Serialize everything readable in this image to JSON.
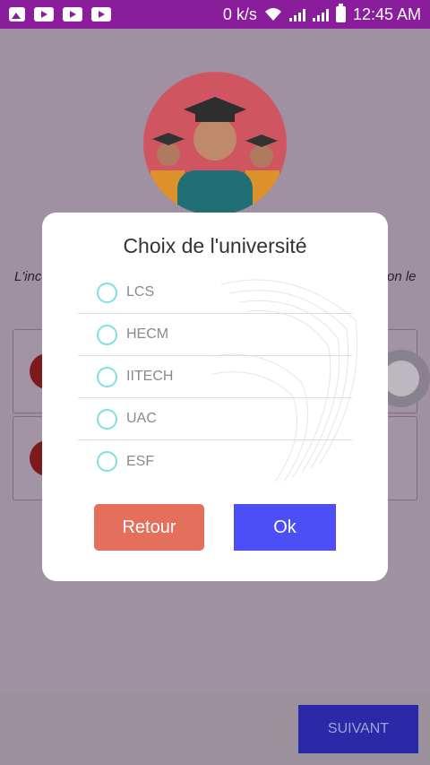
{
  "status_bar": {
    "network_speed": "0 k/s",
    "time": "12:45 AM",
    "icons": [
      "gallery-icon",
      "youtube-icon",
      "youtube-icon",
      "youtube-icon",
      "wifi-icon",
      "signal-icon",
      "signal-icon",
      "battery-icon"
    ]
  },
  "background": {
    "description_left": "L'inc",
    "description_right": "on le",
    "footer": {
      "next_label": "SUIVANT"
    }
  },
  "dialog": {
    "title": "Choix de l'université",
    "options": [
      {
        "label": "LCS",
        "selected": false
      },
      {
        "label": "HECM",
        "selected": false
      },
      {
        "label": "IITECH",
        "selected": false
      },
      {
        "label": "UAC",
        "selected": false
      },
      {
        "label": "ESF",
        "selected": false
      }
    ],
    "cancel_label": "Retour",
    "ok_label": "Ok"
  },
  "colors": {
    "status_bar": "#8a1d9c",
    "overlay": "#a091a2",
    "radio_ring": "#7fe0e0",
    "retour_button": "#e36f5c",
    "ok_button": "#4b4ff5",
    "suivant_button": "#2a2aa8"
  }
}
